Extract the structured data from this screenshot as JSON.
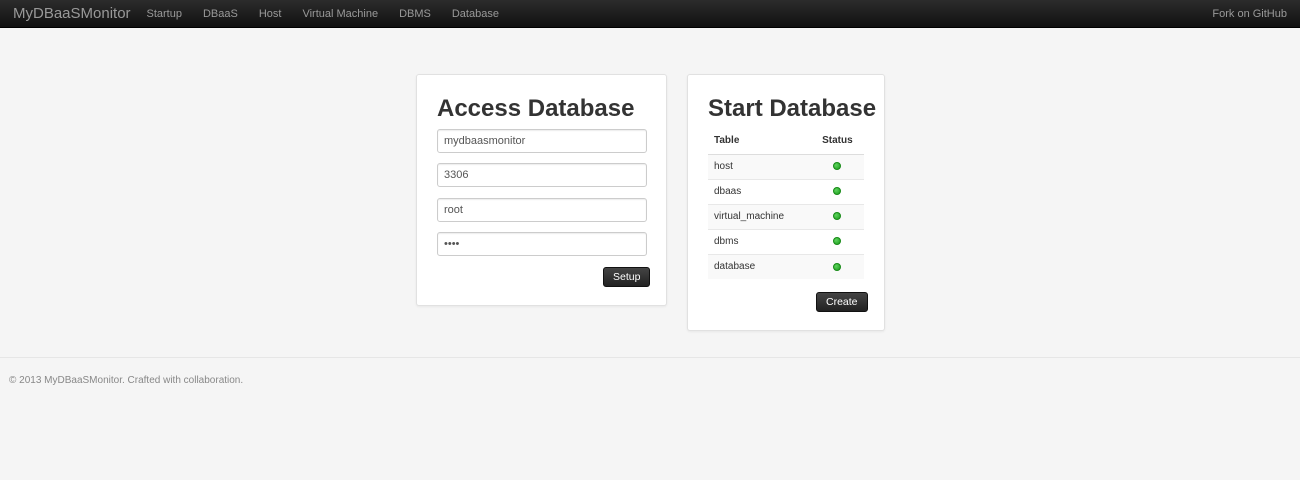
{
  "navbar": {
    "brand": "MyDBaaSMonitor",
    "items": [
      "Startup",
      "DBaaS",
      "Host",
      "Virtual Machine",
      "DBMS",
      "Database"
    ],
    "fork_link": "Fork on GitHub"
  },
  "access": {
    "title": "Access Database",
    "fields": {
      "name": "mydbaasmonitor",
      "port": "3306",
      "user": "root",
      "password": "••••"
    },
    "button": "Setup"
  },
  "start": {
    "title": "Start Database",
    "columns": [
      "Table",
      "Status"
    ],
    "rows": [
      {
        "table": "host",
        "status": "ok"
      },
      {
        "table": "dbaas",
        "status": "ok"
      },
      {
        "table": "virtual_machine",
        "status": "ok"
      },
      {
        "table": "dbms",
        "status": "ok"
      },
      {
        "table": "database",
        "status": "ok"
      }
    ],
    "status_color": "#22aa22",
    "button": "Create"
  },
  "footer": {
    "text": "© 2013 MyDBaaSMonitor. Crafted with collaboration."
  }
}
